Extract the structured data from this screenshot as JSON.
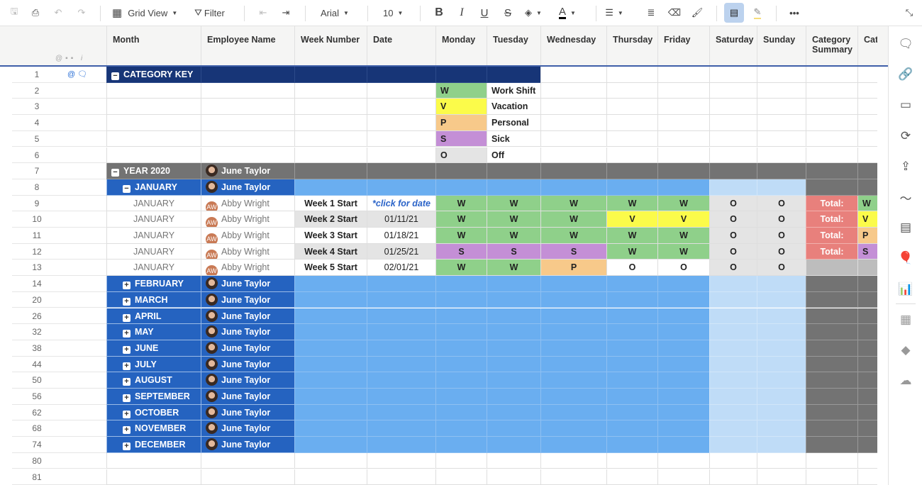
{
  "toolbar": {
    "view_label": "Grid View",
    "filter_label": "Filter",
    "font": "Arial",
    "font_size": "10",
    "icons": [
      "save-icon",
      "print-icon",
      "undo-icon",
      "redo-icon",
      "grid-view-icon",
      "filter-icon",
      "outdent-icon",
      "indent-icon",
      "bold-icon",
      "italic-icon",
      "underline-icon",
      "strikethrough-icon",
      "fill-color-icon",
      "text-color-icon",
      "align-icon",
      "wrap-text-icon",
      "clear-format-icon",
      "format-painter-icon",
      "gridlines-icon",
      "highlight-changes-icon",
      "more-icon",
      "collapse-icon"
    ]
  },
  "columns": [
    "Month",
    "Employee Name",
    "Week Number",
    "Date",
    "Monday",
    "Tuesday",
    "Wednesday",
    "Thursday",
    "Friday",
    "Saturday",
    "Sunday",
    "Category Summary",
    "Categ"
  ],
  "colors": {
    "W": "#8fd08a",
    "V": "#fbfb4a",
    "P": "#f7c98a",
    "S": "#c48fd6",
    "O": "#e4e4e4",
    "key_header": "#173577",
    "year_row": "#737373",
    "month_row": "#2563c0",
    "month_cells": "#6aaef0",
    "weekend_cells": "#bfdcf7",
    "total": "#e8807c",
    "empty_summary": "#bdbdbd"
  },
  "rows": [
    {
      "n": "1",
      "type": "keyhead",
      "label": "CATEGORY KEY"
    },
    {
      "n": "2",
      "type": "key",
      "code": "W",
      "label": "Work Shift"
    },
    {
      "n": "3",
      "type": "key",
      "code": "V",
      "label": "Vacation"
    },
    {
      "n": "4",
      "type": "key",
      "code": "P",
      "label": "Personal"
    },
    {
      "n": "5",
      "type": "key",
      "code": "S",
      "label": "Sick"
    },
    {
      "n": "6",
      "type": "key",
      "code": "O",
      "label": "Off"
    },
    {
      "n": "7",
      "type": "year",
      "label": "YEAR 2020",
      "employee": "June Taylor"
    },
    {
      "n": "8",
      "type": "month",
      "expanded": true,
      "label": "JANUARY",
      "employee": "June Taylor"
    },
    {
      "n": "9",
      "type": "detail",
      "month": "JANUARY",
      "initials": "AW",
      "employee": "Abby Wright",
      "week": "Week 1 Start",
      "date": "*click for date",
      "days": [
        "W",
        "W",
        "W",
        "W",
        "W",
        "O",
        "O"
      ],
      "summary": "Total:",
      "category": "W"
    },
    {
      "n": "10",
      "type": "detail",
      "month": "JANUARY",
      "initials": "AW",
      "employee": "Abby Wright",
      "week": "Week 2 Start",
      "date": "01/11/21",
      "days": [
        "W",
        "W",
        "W",
        "V",
        "V",
        "O",
        "O"
      ],
      "summary": "Total:",
      "category": "V"
    },
    {
      "n": "11",
      "type": "detail",
      "month": "JANUARY",
      "initials": "AW",
      "employee": "Abby Wright",
      "week": "Week 3 Start",
      "date": "01/18/21",
      "days": [
        "W",
        "W",
        "W",
        "W",
        "W",
        "O",
        "O"
      ],
      "summary": "Total:",
      "category": "P"
    },
    {
      "n": "12",
      "type": "detail",
      "month": "JANUARY",
      "initials": "AW",
      "employee": "Abby Wright",
      "week": "Week 4 Start",
      "date": "01/25/21",
      "days": [
        "S",
        "S",
        "S",
        "W",
        "W",
        "O",
        "O"
      ],
      "summary": "Total:",
      "category": "S"
    },
    {
      "n": "13",
      "type": "detail",
      "month": "JANUARY",
      "initials": "AW",
      "employee": "Abby Wright",
      "week": "Week 5 Start",
      "date": "02/01/21",
      "days": [
        "W",
        "W",
        "P",
        "O",
        "O",
        "O",
        "O"
      ],
      "summary": "",
      "category": ""
    },
    {
      "n": "14",
      "type": "month",
      "label": "FEBRUARY",
      "employee": "June Taylor"
    },
    {
      "n": "20",
      "type": "month",
      "label": "MARCH",
      "employee": "June Taylor"
    },
    {
      "n": "26",
      "type": "month",
      "label": "APRIL",
      "employee": "June Taylor"
    },
    {
      "n": "32",
      "type": "month",
      "label": "MAY",
      "employee": "June Taylor"
    },
    {
      "n": "38",
      "type": "month",
      "label": "JUNE",
      "employee": "June Taylor"
    },
    {
      "n": "44",
      "type": "month",
      "label": "JULY",
      "employee": "June Taylor"
    },
    {
      "n": "50",
      "type": "month",
      "label": "AUGUST",
      "employee": "June Taylor"
    },
    {
      "n": "56",
      "type": "month",
      "label": "SEPTEMBER",
      "employee": "June Taylor"
    },
    {
      "n": "62",
      "type": "month",
      "label": "OCTOBER",
      "employee": "June Taylor"
    },
    {
      "n": "68",
      "type": "month",
      "label": "NOVEMBER",
      "employee": "June Taylor"
    },
    {
      "n": "74",
      "type": "month",
      "label": "DECEMBER",
      "employee": "June Taylor"
    },
    {
      "n": "80",
      "type": "empty"
    },
    {
      "n": "81",
      "type": "empty"
    }
  ],
  "rightbar": [
    "comment-icon",
    "attachment-icon",
    "proofs-icon",
    "update-requests-icon",
    "publish-icon",
    "activity-log-icon",
    "forms-icon",
    "connector-icon",
    "summary-icon",
    "apps-icon",
    "jira-icon",
    "salesforce-icon"
  ]
}
